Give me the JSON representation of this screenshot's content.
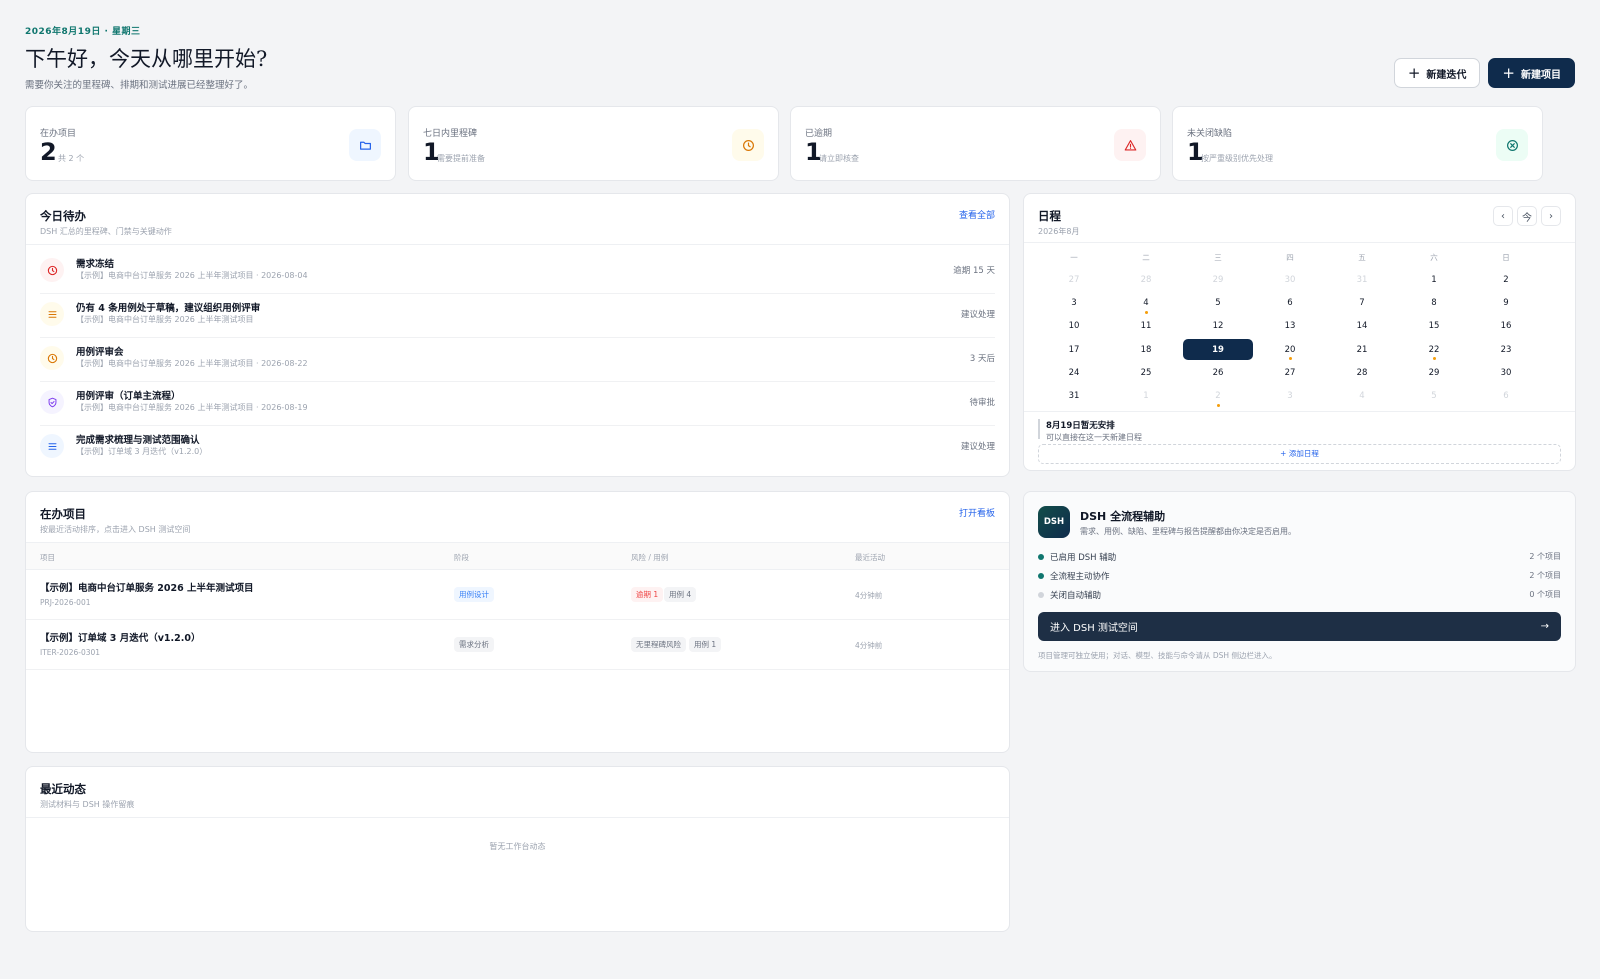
{
  "header": {
    "date": "2026年8月19日 · 星期三",
    "greeting": "下午好，今天从哪里开始?",
    "subtitle": "需要你关注的里程碑、排期和测试进展已经整理好了。",
    "new_iteration": "新建迭代",
    "new_project": "新建项目"
  },
  "stats": [
    {
      "label": "在办项目",
      "value": "2",
      "sub": "共 2 个",
      "icon": "folder-icon",
      "color": "#2563eb"
    },
    {
      "label": "七日内里程碑",
      "value": "1",
      "sub": "需要提前准备",
      "icon": "clock-icon",
      "color": "#d97706"
    },
    {
      "label": "已逾期",
      "value": "1",
      "sub": "请立即核查",
      "icon": "warning-icon",
      "color": "#dc2626"
    },
    {
      "label": "未关闭缺陷",
      "value": "1",
      "sub": "按严重级别优先处理",
      "icon": "close-circle-icon",
      "color": "#0f766e"
    }
  ],
  "todo": {
    "title": "今日待办",
    "subtitle": "DSH 汇总的里程碑、门禁与关键动作",
    "link": "查看全部",
    "items": [
      {
        "title": "需求冻结",
        "meta": "【示例】电商中台订单服务 2026 上半年测试项目 · 2026-08-04",
        "status": "逾期 15 天",
        "icon": "clock-icon"
      },
      {
        "title": "仍有 4 条用例处于草稿，建议组织用例评审",
        "meta": "【示例】电商中台订单服务 2026 上半年测试项目",
        "status": "建议处理",
        "icon": "list-icon"
      },
      {
        "title": "用例评审会",
        "meta": "【示例】电商中台订单服务 2026 上半年测试项目 · 2026-08-22",
        "status": "3 天后",
        "icon": "clock-icon"
      },
      {
        "title": "用例评审（订单主流程）",
        "meta": "【示例】电商中台订单服务 2026 上半年测试项目 · 2026-08-19",
        "status": "待审批",
        "icon": "shield-icon"
      },
      {
        "title": "完成需求梳理与测试范围确认",
        "meta": "【示例】订单域 3 月迭代（v1.2.0）",
        "status": "建议处理",
        "icon": "list-icon"
      }
    ]
  },
  "schedule": {
    "title": "日程",
    "month": "2026年8月",
    "prev": "‹",
    "today_btn": "今",
    "next": "›",
    "weekdays": [
      "一",
      "二",
      "三",
      "四",
      "五",
      "六",
      "日"
    ],
    "weeks": [
      [
        {
          "d": "27",
          "out": true
        },
        {
          "d": "28",
          "out": true
        },
        {
          "d": "29",
          "out": true
        },
        {
          "d": "30",
          "out": true
        },
        {
          "d": "31",
          "out": true
        },
        {
          "d": "1"
        },
        {
          "d": "2"
        }
      ],
      [
        {
          "d": "3"
        },
        {
          "d": "4",
          "dot": true
        },
        {
          "d": "5"
        },
        {
          "d": "6"
        },
        {
          "d": "7"
        },
        {
          "d": "8"
        },
        {
          "d": "9"
        }
      ],
      [
        {
          "d": "10"
        },
        {
          "d": "11"
        },
        {
          "d": "12"
        },
        {
          "d": "13"
        },
        {
          "d": "14"
        },
        {
          "d": "15"
        },
        {
          "d": "16"
        }
      ],
      [
        {
          "d": "17"
        },
        {
          "d": "18"
        },
        {
          "d": "19",
          "today": true
        },
        {
          "d": "20",
          "dot": true
        },
        {
          "d": "21"
        },
        {
          "d": "22",
          "dot": true
        },
        {
          "d": "23"
        }
      ],
      [
        {
          "d": "24"
        },
        {
          "d": "25"
        },
        {
          "d": "26"
        },
        {
          "d": "27"
        },
        {
          "d": "28"
        },
        {
          "d": "29"
        },
        {
          "d": "30"
        }
      ],
      [
        {
          "d": "31"
        },
        {
          "d": "1",
          "out": true
        },
        {
          "d": "2",
          "out": true,
          "dot": true
        },
        {
          "d": "3",
          "out": true
        },
        {
          "d": "4",
          "out": true
        },
        {
          "d": "5",
          "out": true
        },
        {
          "d": "6",
          "out": true
        }
      ]
    ],
    "empty_title": "8月19日暂无安排",
    "empty_sub": "可以直接在这一天新建日程",
    "add": "+ 添加日程"
  },
  "projects": {
    "title": "在办项目",
    "subtitle": "按最近活动排序，点击进入 DSH 测试空间",
    "link": "打开看板",
    "columns": [
      "项目",
      "阶段",
      "风险 / 用例",
      "最近活动"
    ],
    "rows": [
      {
        "name": "【示例】电商中台订单服务 2026 上半年测试项目",
        "code": "PRJ-2026-001",
        "stage": "用例设计",
        "risk": "逾期 1",
        "cases": "用例 4",
        "time": "4分钟前"
      },
      {
        "name": "【示例】订单域 3 月迭代（v1.2.0）",
        "code": "ITER-2026-0301",
        "stage": "需求分析",
        "risk": "无里程碑风险",
        "cases": "用例 1",
        "time": "4分钟前"
      }
    ]
  },
  "activity": {
    "title": "最近动态",
    "subtitle": "测试材料与 DSH 操作留痕",
    "empty": "暂无工作台动态"
  },
  "dsh": {
    "logo": "DSH",
    "title": "DSH 全流程辅助",
    "subtitle": "需求、用例、缺陷、里程碑与报告提醒都由你决定是否启用。",
    "rows": [
      {
        "label": "已启用 DSH 辅助",
        "count": "2 个项目",
        "color": "#0f766e"
      },
      {
        "label": "全流程主动协作",
        "count": "2 个项目",
        "color": "#0f766e"
      },
      {
        "label": "关闭自动辅助",
        "count": "0 个项目",
        "color": "#d1d5db"
      }
    ],
    "enter": "进入 DSH 测试空间",
    "footer": "项目管理可独立使用；对话、模型、技能与命令请从 DSH 侧边栏进入。"
  }
}
